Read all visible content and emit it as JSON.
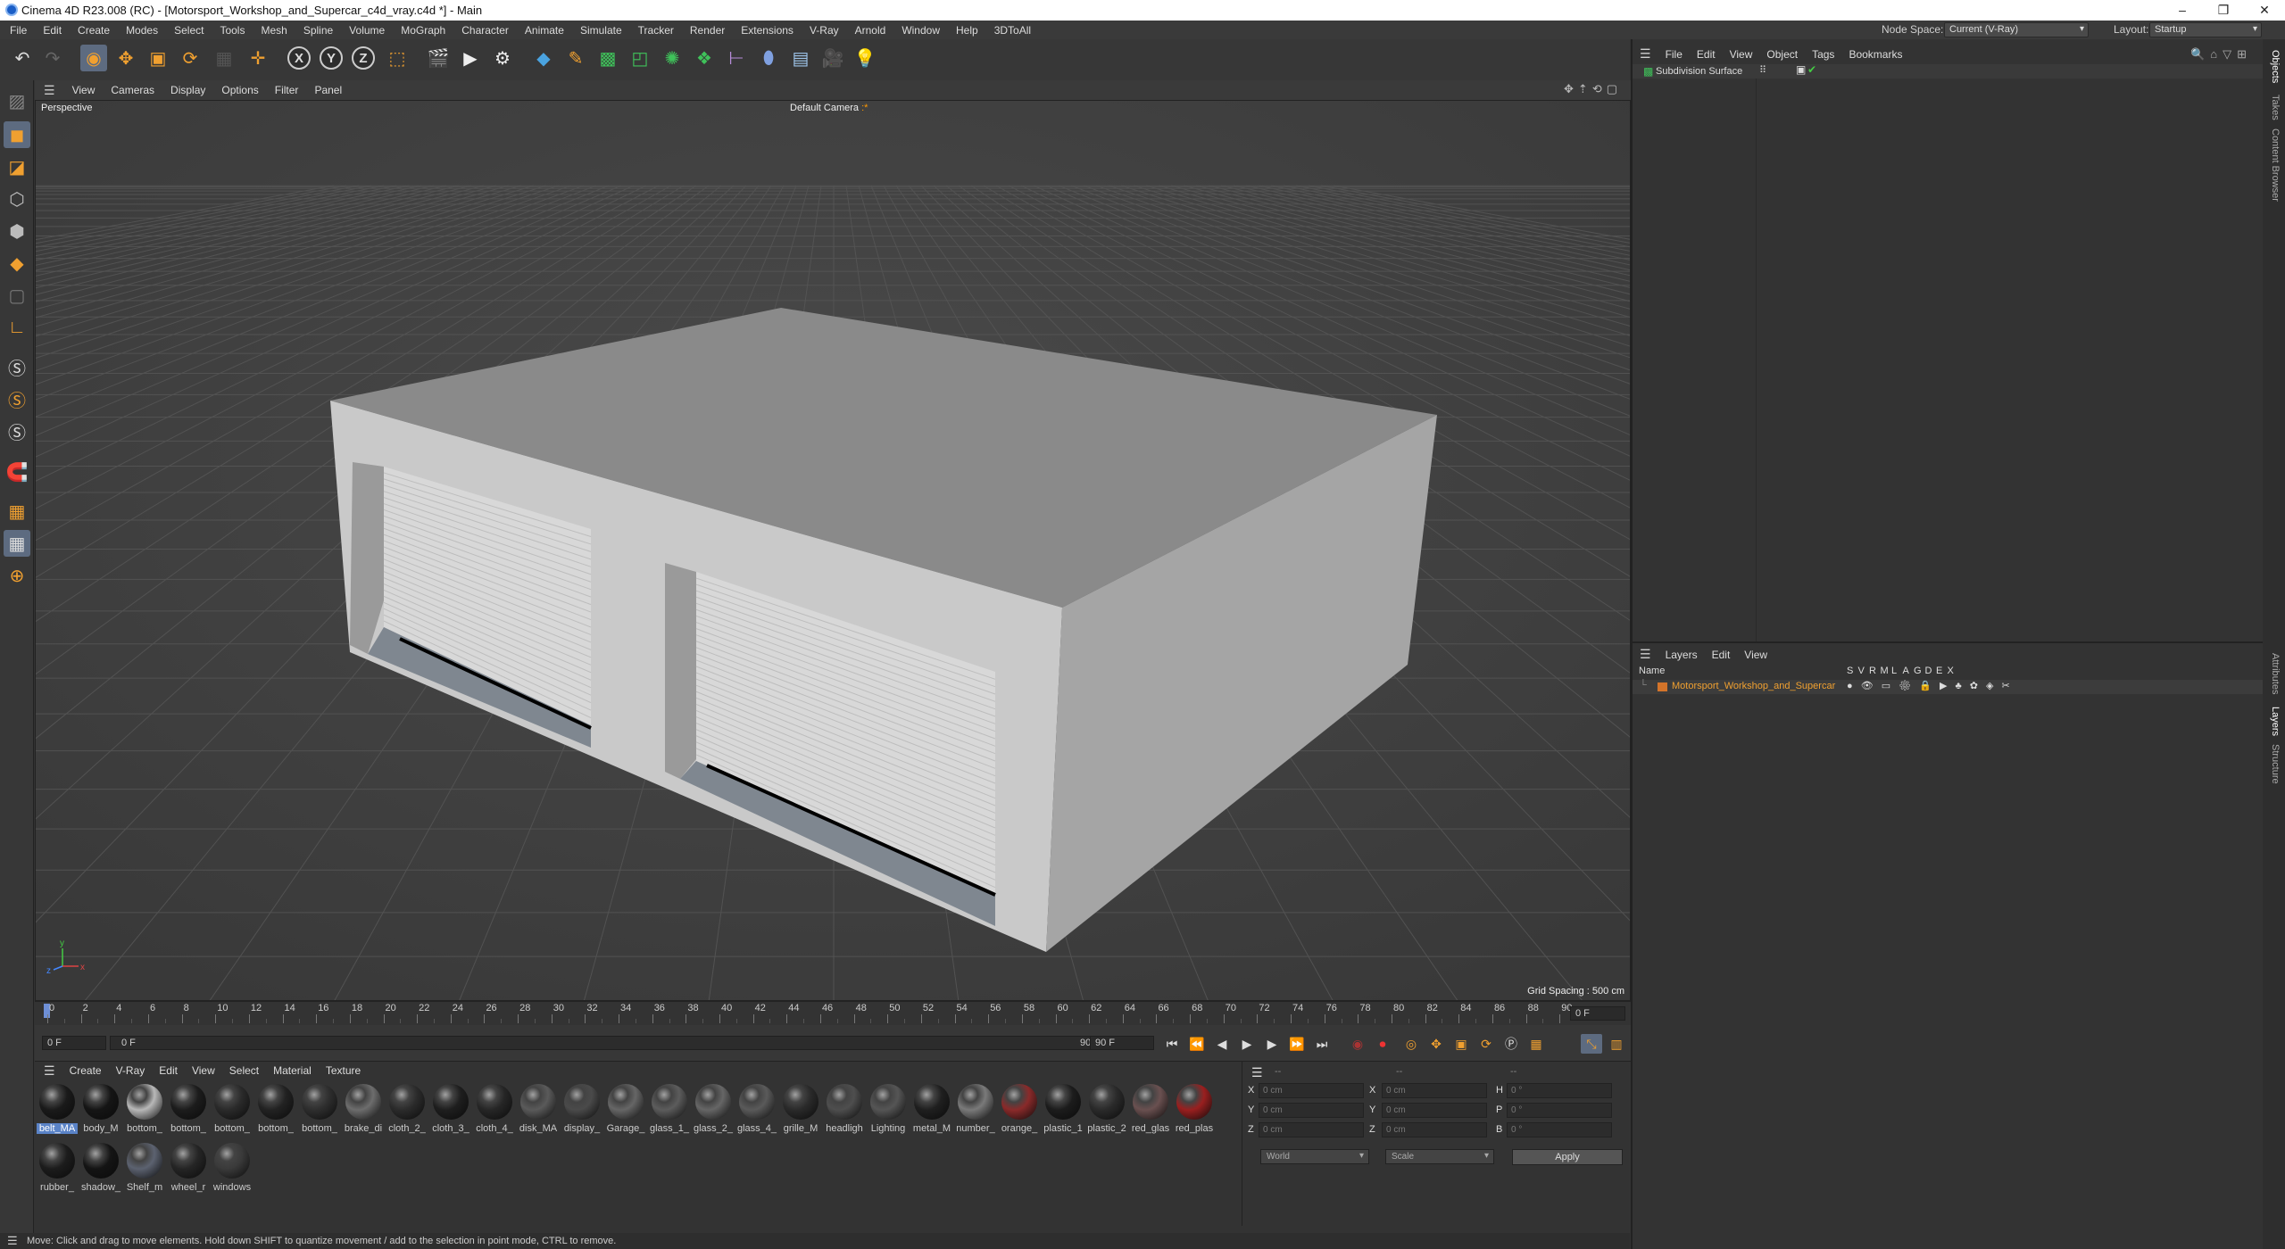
{
  "window": {
    "title": "Cinema 4D R23.008 (RC) - [Motorsport_Workshop_and_Supercar_c4d_vray.c4d *] - Main",
    "controls": [
      "–",
      "❐",
      "✕"
    ]
  },
  "menubar": {
    "items": [
      "File",
      "Edit",
      "Create",
      "Modes",
      "Select",
      "Tools",
      "Mesh",
      "Spline",
      "Volume",
      "MoGraph",
      "Character",
      "Animate",
      "Simulate",
      "Tracker",
      "Render",
      "Extensions",
      "V-Ray",
      "Arnold",
      "Window",
      "Help",
      "3DToAll"
    ],
    "node_space_label": "Node Space:",
    "node_space_value": "Current (V-Ray)",
    "layout_label": "Layout:",
    "layout_value": "Startup"
  },
  "viewport": {
    "menu": [
      "View",
      "Cameras",
      "Display",
      "Options",
      "Filter",
      "Panel"
    ],
    "projection": "Perspective",
    "camera": "Default Camera",
    "camera_marker": ":*",
    "grid_spacing": "Grid Spacing : 500 cm"
  },
  "timeline": {
    "ticks": [
      "0",
      "2",
      "4",
      "6",
      "8",
      "10",
      "12",
      "14",
      "16",
      "18",
      "20",
      "22",
      "24",
      "26",
      "28",
      "30",
      "32",
      "34",
      "36",
      "38",
      "40",
      "42",
      "44",
      "46",
      "48",
      "50",
      "52",
      "54",
      "56",
      "58",
      "60",
      "62",
      "64",
      "66",
      "68",
      "70",
      "72",
      "74",
      "76",
      "78",
      "80",
      "82",
      "84",
      "86",
      "88",
      "90"
    ],
    "current_frame_display": "0 F",
    "start_frame": "0 F",
    "range_start": "0 F",
    "range_end": "90 F",
    "end_frame": "90 F"
  },
  "materials": {
    "menu": [
      "Create",
      "V-Ray",
      "Edit",
      "View",
      "Select",
      "Material",
      "Texture"
    ],
    "items": [
      {
        "name": "belt_MA",
        "color": "#1a1a1a",
        "selected": true
      },
      {
        "name": "body_M",
        "color": "#151515"
      },
      {
        "name": "bottom_",
        "color": "#b8b8b8"
      },
      {
        "name": "bottom_",
        "color": "#1c1c1c"
      },
      {
        "name": "bottom_",
        "color": "#2a2a2a"
      },
      {
        "name": "bottom_",
        "color": "#222222"
      },
      {
        "name": "bottom_",
        "color": "#2e2e2e"
      },
      {
        "name": "brake_di",
        "color": "#6d6d6d"
      },
      {
        "name": "cloth_2_",
        "color": "#2b2b2b"
      },
      {
        "name": "cloth_3_",
        "color": "#1e1e1e"
      },
      {
        "name": "cloth_4_",
        "color": "#262626"
      },
      {
        "name": "disk_MA",
        "color": "#5a5a5a"
      },
      {
        "name": "display_",
        "color": "#4a4a4a"
      },
      {
        "name": "Garage_",
        "color": "#666666"
      },
      {
        "name": "glass_1_",
        "color": "#5c5c5c"
      },
      {
        "name": "glass_2_",
        "color": "#666666"
      },
      {
        "name": "glass_4_",
        "color": "#5a5a5a"
      },
      {
        "name": "grille_M",
        "color": "#2a2a2a"
      },
      {
        "name": "headligh",
        "color": "#4e4e4e"
      },
      {
        "name": "Lighting",
        "color": "#555555"
      },
      {
        "name": "metal_M",
        "color": "#1f1f1f"
      },
      {
        "name": "number_",
        "color": "#7a7a7a"
      },
      {
        "name": "orange_",
        "color": "#8a2a2a"
      },
      {
        "name": "plastic_1",
        "color": "#1c1c1c"
      },
      {
        "name": "plastic_2",
        "color": "#2a2a2a"
      },
      {
        "name": "red_glas",
        "color": "#6a5050"
      },
      {
        "name": "red_plas",
        "color": "#9a1f1f"
      },
      {
        "name": "rubber_",
        "color": "#1c1c1c"
      },
      {
        "name": "shadow_",
        "color": "#141414"
      },
      {
        "name": "Shelf_m",
        "color": "#5c6270"
      },
      {
        "name": "wheel_r",
        "color": "#252525"
      },
      {
        "name": "windows",
        "color": "#3a3a3a"
      }
    ]
  },
  "coordinates": {
    "header_dashes": [
      "--",
      "--",
      "--"
    ],
    "rows": [
      {
        "axis": "X",
        "pos": "0 cm",
        "axis2": "X",
        "size": "0 cm",
        "axis3": "H",
        "rot": "0 °"
      },
      {
        "axis": "Y",
        "pos": "0 cm",
        "axis2": "Y",
        "size": "0 cm",
        "axis3": "P",
        "rot": "0 °"
      },
      {
        "axis": "Z",
        "pos": "0 cm",
        "axis2": "Z",
        "size": "0 cm",
        "axis3": "B",
        "rot": "0 °"
      }
    ],
    "coord_system": "World",
    "size_mode": "Scale",
    "apply_label": "Apply"
  },
  "status": {
    "message": "Move: Click and drag to move elements. Hold down SHIFT to quantize movement / add to the selection in point mode, CTRL to remove."
  },
  "object_manager": {
    "menu": [
      "File",
      "Edit",
      "View",
      "Object",
      "Tags",
      "Bookmarks"
    ],
    "objects": [
      {
        "name": "Subdivision Surface"
      }
    ]
  },
  "layer_manager": {
    "menu": [
      "Layers",
      "Edit",
      "View"
    ],
    "name_header": "Name",
    "flag_headers": [
      "S",
      "V",
      "R",
      "M",
      "L",
      "A",
      "G",
      "D",
      "E",
      "X"
    ],
    "layers": [
      {
        "name": "Motorsport_Workshop_and_Supercar",
        "color": "#d4742a"
      }
    ]
  },
  "side_tabs": {
    "top": [
      "Objects",
      "Takes",
      "Content Browser"
    ],
    "bottom": [
      "Attributes",
      "Layers",
      "Structure"
    ]
  }
}
